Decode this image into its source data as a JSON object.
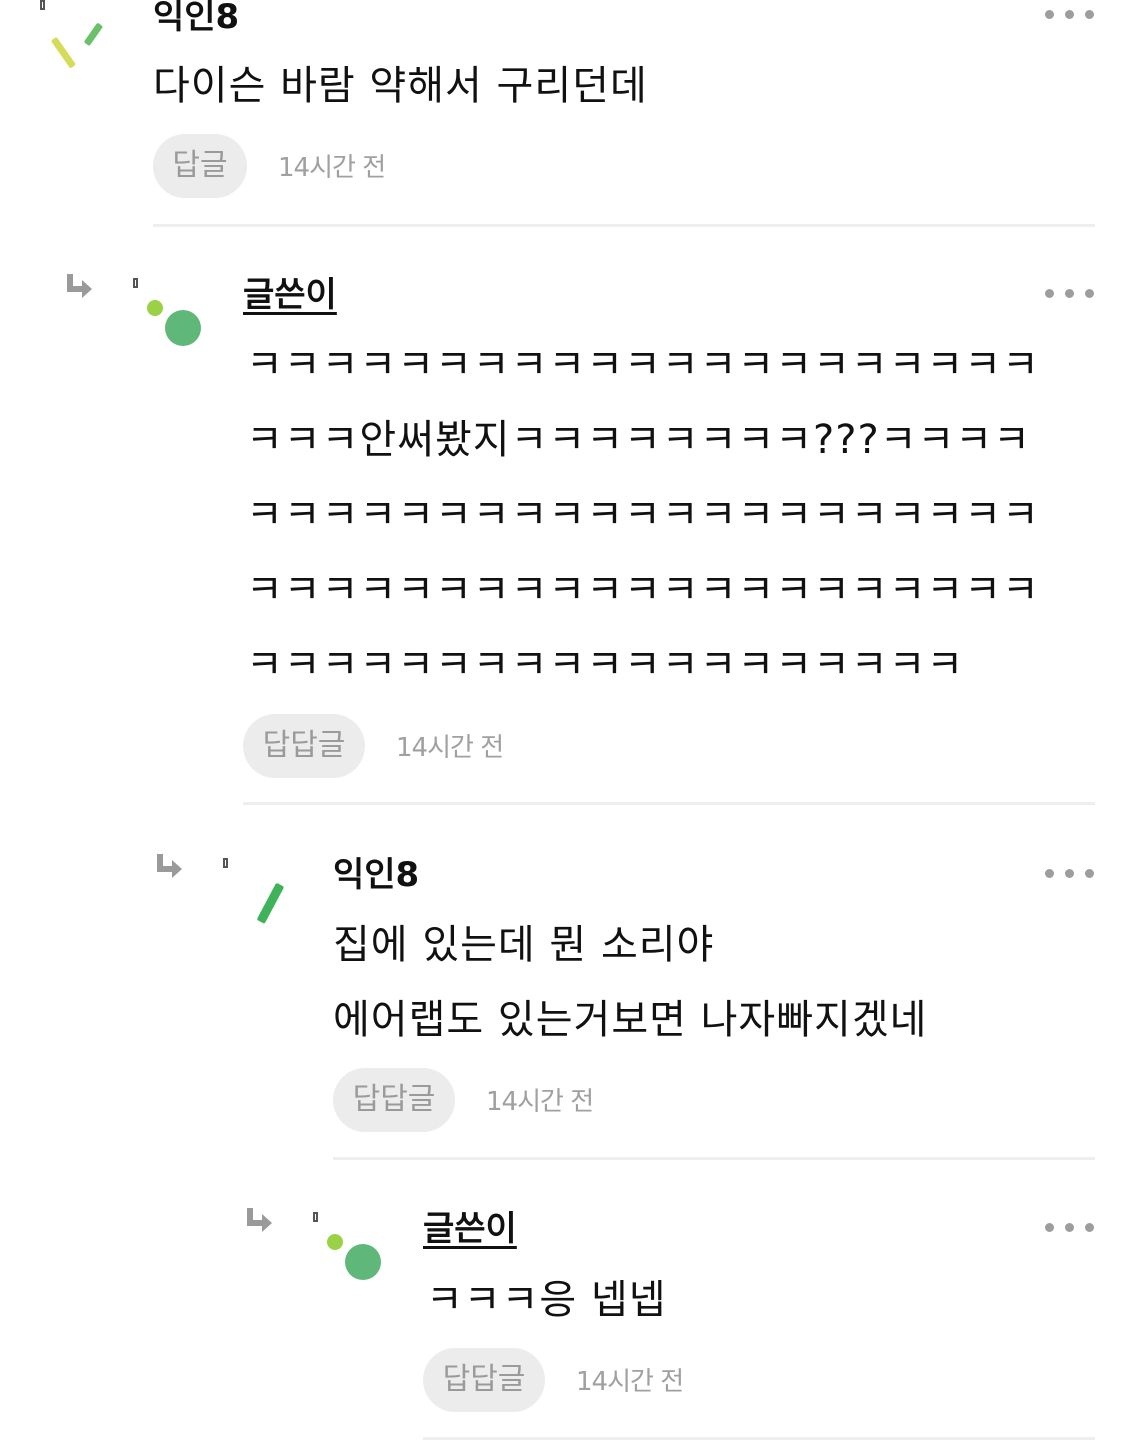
{
  "comments": [
    {
      "author": "익인8",
      "lines": [
        "다이슨 바람 약해서 구리던데"
      ],
      "reply_label": "답글",
      "time": "14시간 전"
    },
    {
      "author": "글쓴이",
      "lines": [
        "ㅋㅋㅋㅋㅋㅋㅋㅋㅋㅋㅋㅋㅋㅋㅋㅋㅋㅋㅋㅋㅋ",
        "ㅋㅋㅋ안써봤지ㅋㅋㅋㅋㅋㅋㅋㅋ???ㅋㅋㅋㅋ",
        "ㅋㅋㅋㅋㅋㅋㅋㅋㅋㅋㅋㅋㅋㅋㅋㅋㅋㅋㅋㅋㅋ",
        "ㅋㅋㅋㅋㅋㅋㅋㅋㅋㅋㅋㅋㅋㅋㅋㅋㅋㅋㅋㅋㅋ",
        "ㅋㅋㅋㅋㅋㅋㅋㅋㅋㅋㅋㅋㅋㅋㅋㅋㅋㅋㅋ"
      ],
      "reply_label": "답답글",
      "time": "14시간 전"
    },
    {
      "author": "익인8",
      "lines": [
        "집에 있는데 뭔 소리야",
        "에어랩도 있는거보면 나자빠지겠네"
      ],
      "reply_label": "답답글",
      "time": "14시간 전"
    },
    {
      "author": "글쓴이",
      "lines": [
        "ㅋㅋㅋ응 넵넵"
      ],
      "reply_label": "답답글",
      "time": "14시간 전"
    }
  ],
  "icons": {
    "more": "more-options-icon",
    "reply_arrow": "reply-arrow-icon",
    "avatar": "avatar-icon"
  },
  "colors": {
    "avatar_green": "#5fb87a",
    "avatar_lime": "#9bd146",
    "avatar_yellow": "#d4dc5a",
    "button_bg": "#ececec",
    "muted_text": "#a0a0a0"
  }
}
